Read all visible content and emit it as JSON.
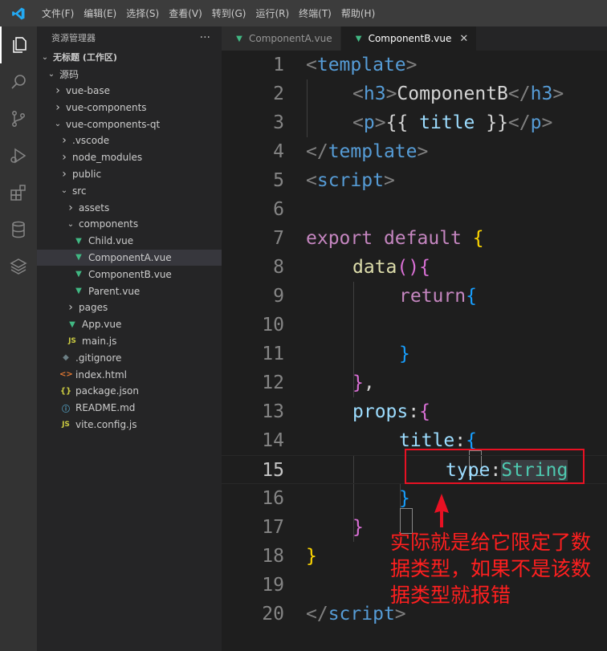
{
  "menu": [
    "文件(F)",
    "编辑(E)",
    "选择(S)",
    "查看(V)",
    "转到(G)",
    "运行(R)",
    "终端(T)",
    "帮助(H)"
  ],
  "activity_bar": [
    "explorer-icon",
    "search-icon",
    "source-control-icon",
    "run-debug-icon",
    "extensions-icon",
    "database-icon",
    "layers-icon"
  ],
  "sidebar": {
    "title": "资源管理器",
    "more": "···",
    "tree": [
      {
        "label": "无标题 (工作区)",
        "depth": 0,
        "chevron": "open",
        "bold": true
      },
      {
        "label": "源码",
        "depth": 1,
        "chevron": "open"
      },
      {
        "label": "vue-base",
        "depth": 2,
        "chevron": "closed"
      },
      {
        "label": "vue-components",
        "depth": 2,
        "chevron": "closed"
      },
      {
        "label": "vue-components-qt",
        "depth": 2,
        "chevron": "open"
      },
      {
        "label": ".vscode",
        "depth": 3,
        "chevron": "closed"
      },
      {
        "label": "node_modules",
        "depth": 3,
        "chevron": "closed"
      },
      {
        "label": "public",
        "depth": 3,
        "chevron": "closed"
      },
      {
        "label": "src",
        "depth": 3,
        "chevron": "open"
      },
      {
        "label": "assets",
        "depth": 4,
        "chevron": "closed"
      },
      {
        "label": "components",
        "depth": 4,
        "chevron": "open"
      },
      {
        "label": "Child.vue",
        "depth": 5,
        "icon": "vue"
      },
      {
        "label": "ComponentA.vue",
        "depth": 5,
        "icon": "vue",
        "selected": true
      },
      {
        "label": "ComponentB.vue",
        "depth": 5,
        "icon": "vue"
      },
      {
        "label": "Parent.vue",
        "depth": 5,
        "icon": "vue"
      },
      {
        "label": "pages",
        "depth": 4,
        "chevron": "closed"
      },
      {
        "label": "App.vue",
        "depth": 4,
        "icon": "vue"
      },
      {
        "label": "main.js",
        "depth": 4,
        "icon": "js"
      },
      {
        "label": ".gitignore",
        "depth": 3,
        "icon": "git"
      },
      {
        "label": "index.html",
        "depth": 3,
        "icon": "html"
      },
      {
        "label": "package.json",
        "depth": 3,
        "icon": "json"
      },
      {
        "label": "README.md",
        "depth": 3,
        "icon": "info"
      },
      {
        "label": "vite.config.js",
        "depth": 3,
        "icon": "js"
      }
    ]
  },
  "tabs": [
    {
      "label": "ComponentA.vue",
      "active": false
    },
    {
      "label": "ComponentB.vue",
      "active": true,
      "close": "✕"
    }
  ],
  "icons": {
    "vue": "▼",
    "js": "JS",
    "git": "◆",
    "html": "<>",
    "json": "{}",
    "info": "ⓘ"
  },
  "code": {
    "current_line": 15,
    "lines": [
      {
        "n": "1",
        "tokens": [
          [
            "tag_punc",
            "<"
          ],
          [
            "tag",
            "template"
          ],
          [
            "tag_punc",
            ">"
          ]
        ]
      },
      {
        "n": "2",
        "indent": 1,
        "tokens": [
          [
            "tag_punc",
            "<"
          ],
          [
            "tag",
            "h3"
          ],
          [
            "tag_punc",
            ">"
          ],
          [
            "plain",
            "ComponentB"
          ],
          [
            "tag_punc",
            "</"
          ],
          [
            "tag",
            "h3"
          ],
          [
            "tag_punc",
            ">"
          ]
        ]
      },
      {
        "n": "3",
        "indent": 1,
        "tokens": [
          [
            "tag_punc",
            "<"
          ],
          [
            "tag",
            "p"
          ],
          [
            "tag_punc",
            ">"
          ],
          [
            "plain",
            "{{ "
          ],
          [
            "prop",
            "title"
          ],
          [
            "plain",
            " }}"
          ],
          [
            "tag_punc",
            "</"
          ],
          [
            "tag",
            "p"
          ],
          [
            "tag_punc",
            ">"
          ]
        ]
      },
      {
        "n": "4",
        "tokens": [
          [
            "tag_punc",
            "</"
          ],
          [
            "tag",
            "template"
          ],
          [
            "tag_punc",
            ">"
          ]
        ]
      },
      {
        "n": "5",
        "tokens": [
          [
            "tag_punc",
            "<"
          ],
          [
            "tag",
            "script"
          ],
          [
            "tag_punc",
            ">"
          ]
        ]
      },
      {
        "n": "6",
        "tokens": []
      },
      {
        "n": "7",
        "tokens": [
          [
            "kw",
            "export"
          ],
          [
            "plain",
            " "
          ],
          [
            "kw",
            "default"
          ],
          [
            "plain",
            " "
          ],
          [
            "brk",
            "{"
          ]
        ]
      },
      {
        "n": "8",
        "indent": 1,
        "tokens": [
          [
            "fn",
            "data"
          ],
          [
            "brk2",
            "()"
          ],
          [
            "brk2",
            "{"
          ]
        ]
      },
      {
        "n": "9",
        "indent": 2,
        "tokens": [
          [
            "kw",
            "return"
          ],
          [
            "brk3",
            "{"
          ]
        ]
      },
      {
        "n": "10",
        "tokens": []
      },
      {
        "n": "11",
        "indent": 2,
        "tokens": [
          [
            "brk3",
            "}"
          ]
        ]
      },
      {
        "n": "12",
        "indent": 1,
        "tokens": [
          [
            "brk2",
            "}"
          ],
          [
            "plain",
            ","
          ]
        ]
      },
      {
        "n": "13",
        "indent": 1,
        "tokens": [
          [
            "prop",
            "props"
          ],
          [
            "plain",
            ":"
          ],
          [
            "brk2",
            "{"
          ]
        ]
      },
      {
        "n": "14",
        "indent": 2,
        "tokens": [
          [
            "prop",
            "title"
          ],
          [
            "plain",
            ":"
          ],
          [
            "brk3",
            "{"
          ]
        ]
      },
      {
        "n": "15",
        "indent": 3,
        "tokens": [
          [
            "prop",
            "type"
          ],
          [
            "plain",
            ":"
          ],
          [
            "type",
            "String"
          ]
        ]
      },
      {
        "n": "16",
        "indent": 2,
        "tokens": [
          [
            "brk3",
            "}"
          ]
        ]
      },
      {
        "n": "17",
        "indent": 1,
        "tokens": [
          [
            "brk2",
            "}"
          ]
        ]
      },
      {
        "n": "18",
        "tokens": [
          [
            "brk",
            "}"
          ]
        ]
      },
      {
        "n": "19",
        "tokens": []
      },
      {
        "n": "20",
        "tokens": [
          [
            "tag_punc",
            "</"
          ],
          [
            "tag",
            "script"
          ],
          [
            "tag_punc",
            ">"
          ]
        ]
      }
    ]
  },
  "annotation": {
    "text": "实际就是给它限定了数据类型，如果不是该数据类型就报错",
    "arrow_color": "#e81123"
  },
  "colors": {
    "accent": "#007acc",
    "annotation": "#ff1f1f",
    "tag": "#569cd6",
    "keyword": "#c586c0",
    "function": "#dcdcaa",
    "property": "#9cdcfe",
    "type": "#4ec9b0",
    "bracket_gold": "#ffd700",
    "bracket_purple": "#da70d6",
    "bracket_blue": "#179fff"
  }
}
